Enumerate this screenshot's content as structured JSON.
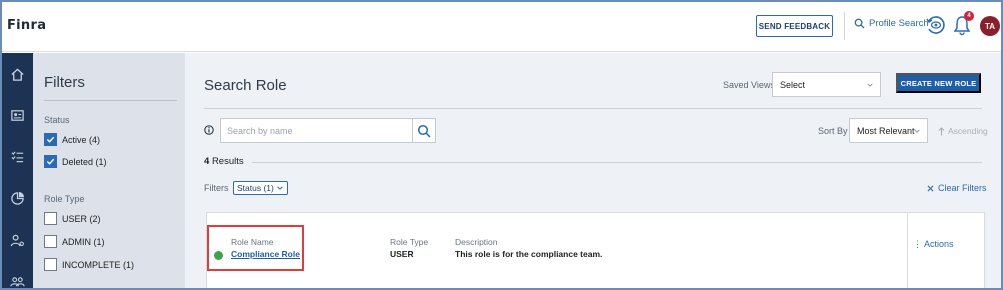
{
  "header": {
    "logo": "Finra",
    "send_feedback": "SEND FEEDBACK",
    "profile_search": "Profile Search",
    "notification_count": "4",
    "avatar_initials": "TA"
  },
  "filters": {
    "title": "Filters",
    "status_label": "Status",
    "status_options": [
      {
        "label": "Active (4)",
        "checked": true
      },
      {
        "label": "Deleted (1)",
        "checked": true
      }
    ],
    "role_type_label": "Role Type",
    "role_type_options": [
      {
        "label": "USER (2)",
        "checked": false
      },
      {
        "label": "ADMIN (1)",
        "checked": false
      },
      {
        "label": "INCOMPLETE (1)",
        "checked": false
      }
    ]
  },
  "main": {
    "title": "Search Role",
    "saved_views_label": "Saved Views",
    "saved_views_value": "Select",
    "create_button": "CREATE NEW ROLE",
    "search_placeholder": "Search by name",
    "sort_by_label": "Sort By",
    "sort_by_value": "Most Relevant",
    "ascending_label": "Ascending",
    "results_count": "4",
    "results_label": "Results",
    "filters_label": "Filters",
    "active_filter_chip": "Status (1)",
    "clear_filters": "Clear Filters"
  },
  "results": [
    {
      "role_name_label": "Role Name",
      "role_name": "Compliance Role",
      "role_type_label": "Role Type",
      "role_type": "USER",
      "description_label": "Description",
      "description": "This role is for the compliance team.",
      "actions_label": "Actions",
      "status_color": "#3fa34d"
    }
  ],
  "colors": {
    "nav_bg": "#1c3354",
    "accent": "#1f5fa8",
    "highlight": "#d9403d"
  }
}
